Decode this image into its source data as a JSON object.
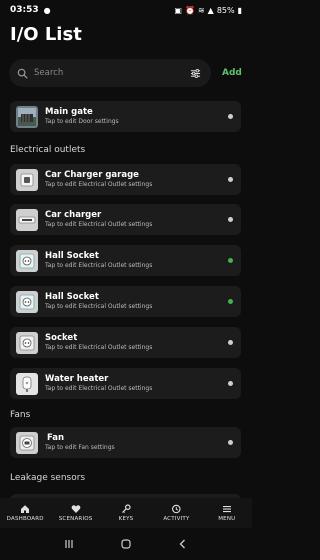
{
  "status_bar": {
    "time": "03:53",
    "battery": "85%"
  },
  "page_title": "I/O List",
  "search": {
    "placeholder": "Search",
    "add_label": "Add"
  },
  "sections": {
    "electrical": "Electrical outlets",
    "fans": "Fans",
    "leakage": "Leakage sensors"
  },
  "items": [
    {
      "name": "Main gate",
      "subtitle": "Tap to edit Door settings",
      "status": "off",
      "icon": "gate-photo-icon"
    },
    {
      "name": "Car Charger garage",
      "subtitle": "Tap to edit Electrical Outlet settings",
      "status": "off",
      "icon": "outlet-icon"
    },
    {
      "name": "Car charger",
      "subtitle": "Tap to edit Electrical Outlet settings",
      "status": "off",
      "icon": "car-charger-icon"
    },
    {
      "name": "Hall Socket",
      "subtitle": "Tap to edit Electrical Outlet settings",
      "status": "on",
      "icon": "socket-icon"
    },
    {
      "name": "Hall Socket",
      "subtitle": "Tap to edit Electrical Outlet settings",
      "status": "on",
      "icon": "socket-icon"
    },
    {
      "name": "Socket",
      "subtitle": "Tap to edit Electrical Outlet settings",
      "status": "off",
      "icon": "socket-icon"
    },
    {
      "name": "Water heater",
      "subtitle": "Tap to edit Electrical Outlet settings",
      "status": "off",
      "icon": "water-heater-icon"
    },
    {
      "name": "Fan",
      "subtitle": "Tap to edit Fan settings",
      "status": "off",
      "icon": "fan-icon"
    }
  ],
  "nav": [
    {
      "label": "DASHBOARD",
      "icon": "home-icon"
    },
    {
      "label": "SCENARIOS",
      "icon": "heart-icon"
    },
    {
      "label": "KEYS",
      "icon": "key-icon"
    },
    {
      "label": "ACTIVITY",
      "icon": "history-icon"
    },
    {
      "label": "MENU",
      "icon": "menu-icon"
    }
  ],
  "colors": {
    "background": "#0d0d0d",
    "card": "#1c1c1c",
    "accent": "#5ec26a",
    "status_on": "#47b04f",
    "status_off": "#cfcfcf"
  }
}
